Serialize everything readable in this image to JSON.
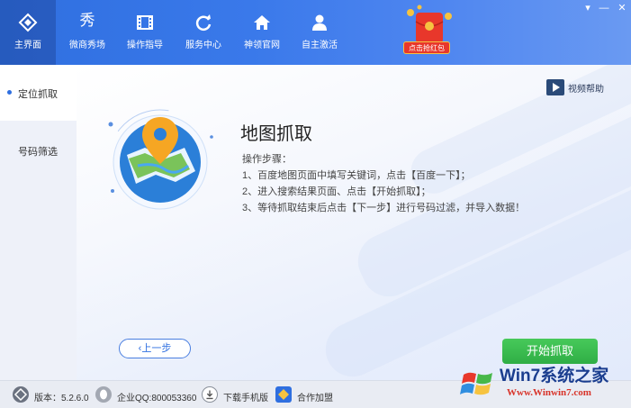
{
  "nav": {
    "items": [
      {
        "label": "主界面",
        "icon": "home-logo-icon",
        "active": true
      },
      {
        "label": "微商秀场",
        "icon": "xiu-icon"
      },
      {
        "label": "操作指导",
        "icon": "film-icon"
      },
      {
        "label": "服务中心",
        "icon": "refresh-icon"
      },
      {
        "label": "神领官网",
        "icon": "house-icon"
      },
      {
        "label": "自主激活",
        "icon": "user-icon"
      }
    ],
    "xiu_glyph": "秀",
    "redpacket_label": "点击抢红包"
  },
  "window": {
    "menu_glyph": "▾",
    "min_glyph": "—",
    "close_glyph": "✕"
  },
  "sidebar": {
    "items": [
      {
        "label": "定位抓取",
        "active": true
      },
      {
        "label": "号码筛选"
      }
    ]
  },
  "main": {
    "video_help": "视频帮助",
    "title": "地图抓取",
    "steps_heading": "操作步骤：",
    "steps": [
      "1、百度地图页面中填写关键词，点击【百度一下】；",
      "2、进入搜索结果页面、点击【开始抓取】；",
      "3、等待抓取结束后点击【下一步】进行号码过滤，并导入数据！"
    ],
    "prev_button": "‹上一步",
    "start_button": "开始抓取"
  },
  "footer": {
    "version": "版本：5.2.6.0",
    "qq": "企业QQ:800053360",
    "download": "下载手机版",
    "join": "合作加盟"
  },
  "watermark": {
    "title": "Win7系统之家",
    "url": "Www.Winwin7.com"
  },
  "colors": {
    "header_blue": "#2f6fe0",
    "start_green": "#2fae45",
    "redpacket_red": "#e8372b"
  }
}
